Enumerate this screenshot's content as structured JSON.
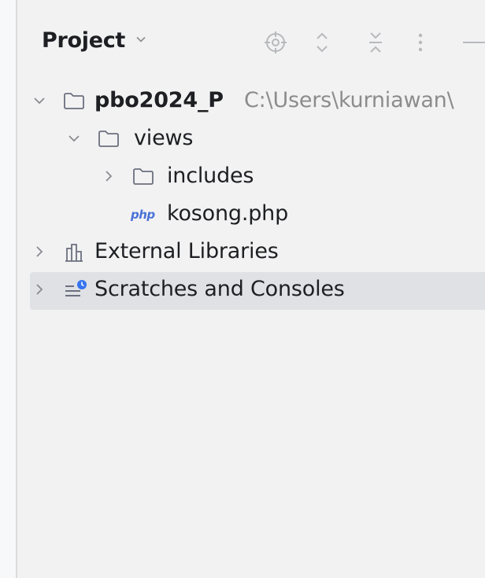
{
  "panel": {
    "title": "Project",
    "toolbar": {
      "icons": [
        "locate-icon",
        "expand-all-icon",
        "collapse-all-icon",
        "more-options-icon",
        "hide-icon"
      ]
    }
  },
  "tree": {
    "root": {
      "label": "pbo2024_P",
      "path": "C:\\Users\\kurniawan\\"
    },
    "views": {
      "label": "views"
    },
    "includes": {
      "label": "includes"
    },
    "kosong": {
      "badge": "php",
      "label": "kosong.php"
    },
    "external": {
      "label": "External Libraries"
    },
    "scratches": {
      "label": "Scratches and Consoles"
    }
  },
  "colors": {
    "background": "#f2f2f3",
    "selection": "#dfe1e5",
    "path_text": "#8c8c8c",
    "php_badge": "#4a72d8",
    "scratch_badge": "#3574f0"
  }
}
